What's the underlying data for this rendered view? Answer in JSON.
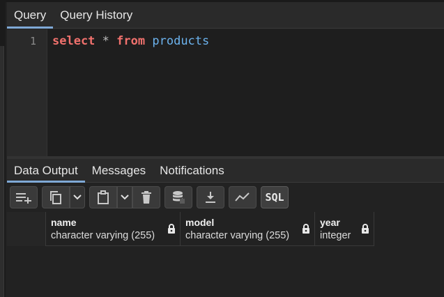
{
  "query_tabs": [
    "Query",
    "Query History"
  ],
  "editor": {
    "line_numbers": [
      "1"
    ],
    "code": {
      "kw1": "select",
      "op": "*",
      "kw2": "from",
      "ident": "products"
    }
  },
  "output_tabs": [
    "Data Output",
    "Messages",
    "Notifications"
  ],
  "toolbar": {
    "sql_label": "SQL"
  },
  "grid": {
    "columns": [
      {
        "name": "name",
        "type": "character varying (255)"
      },
      {
        "name": "model",
        "type": "character varying (255)"
      },
      {
        "name": "year",
        "type": "integer"
      }
    ]
  },
  "colors": {
    "keyword": "#f0716d",
    "identifier": "#6cb3ee",
    "active_tab_underline": "#7fa9d6"
  }
}
